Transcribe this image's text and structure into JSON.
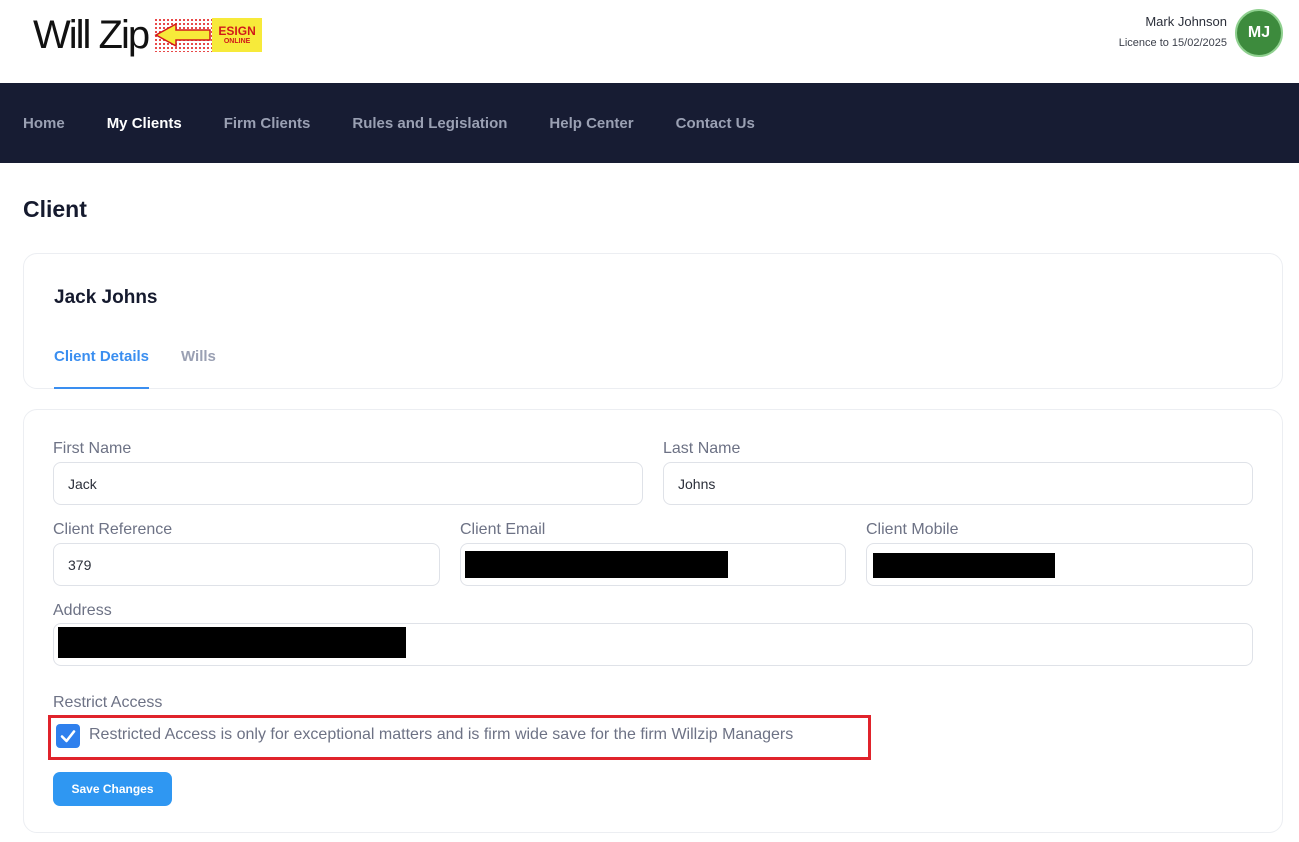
{
  "brand": {
    "name": "Will Zip",
    "badge_line1": "ESIGN",
    "badge_line2": "ONLINE"
  },
  "user": {
    "name": "Mark Johnson",
    "licence": "Licence to 15/02/2025",
    "initials": "MJ"
  },
  "nav": {
    "items": [
      {
        "label": "Home",
        "active": false
      },
      {
        "label": "My Clients",
        "active": true
      },
      {
        "label": "Firm Clients",
        "active": false
      },
      {
        "label": "Rules and Legislation",
        "active": false
      },
      {
        "label": "Help Center",
        "active": false
      },
      {
        "label": "Contact Us",
        "active": false
      }
    ]
  },
  "page": {
    "title": "Client"
  },
  "client": {
    "name": "Jack Johns",
    "tabs": [
      {
        "label": "Client Details",
        "active": true
      },
      {
        "label": "Wills",
        "active": false
      }
    ]
  },
  "form": {
    "first_name": {
      "label": "First Name",
      "value": "Jack"
    },
    "last_name": {
      "label": "Last Name",
      "value": "Johns"
    },
    "reference": {
      "label": "Client Reference",
      "value": "379"
    },
    "email": {
      "label": "Client Email",
      "value": ""
    },
    "mobile": {
      "label": "Client Mobile",
      "value": ""
    },
    "address": {
      "label": "Address",
      "value": ""
    },
    "restrict": {
      "label": "Restrict Access",
      "checked": true,
      "text": "Restricted Access is only for exceptional matters and is firm wide save for the firm Willzip Managers"
    },
    "save_label": "Save Changes"
  },
  "colors": {
    "nav_bg": "#171c33",
    "accent": "#2f97f2",
    "avatar_bg": "#3d8b3d",
    "highlight": "#e0232b"
  },
  "icons": {
    "checkbox": "check-icon",
    "logo_arrow": "arrow-left-icon"
  }
}
